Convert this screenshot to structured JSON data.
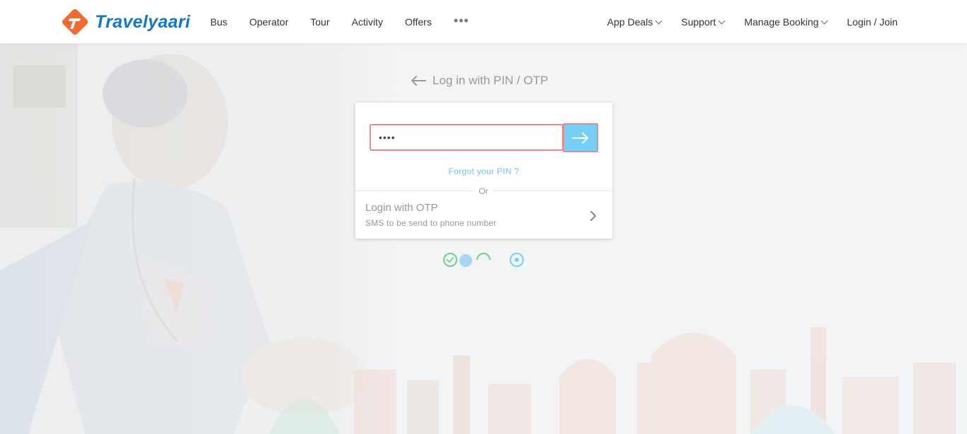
{
  "header": {
    "logo_text": "Travelyaari",
    "nav_left": [
      "Bus",
      "Operator",
      "Tour",
      "Activity",
      "Offers"
    ],
    "more_label": "•••",
    "nav_right": [
      {
        "label": "App Deals",
        "dropdown": true
      },
      {
        "label": "Support",
        "dropdown": true
      },
      {
        "label": "Manage Booking",
        "dropdown": true
      },
      {
        "label": "Login / Join",
        "dropdown": false
      }
    ]
  },
  "login": {
    "back_label": "Log in with PIN / OTP",
    "pin_value": "••••",
    "forgot_label": "Forgot your PIN ?",
    "or_label": "Or",
    "otp_title": "Login with OTP",
    "otp_subtitle": "SMS to be send to phone number"
  },
  "colors": {
    "brand_orange": "#f26a2e",
    "brand_blue": "#1677c5",
    "accent_light_blue": "#76d0f5",
    "error_border": "#e88a8a",
    "step_green": "#6fd08c"
  },
  "icons": {
    "back": "arrow-left-icon",
    "submit": "arrow-right-icon",
    "otp": "chevron-right-icon",
    "dropdown": "chevron-down-icon"
  }
}
